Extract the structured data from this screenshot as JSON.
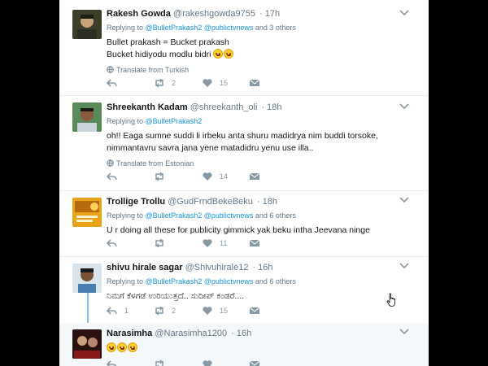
{
  "colors": {
    "accent": "#1b95e0",
    "muted": "#657786",
    "action": "#8899a6",
    "thread": "#80c6ea"
  },
  "tweets": [
    {
      "name": "Rakesh Gowda",
      "handle": "@rakeshgowda9755",
      "time": "17h",
      "replying_prefix": "Replying to ",
      "mentions": "@BulletPrakash2 @publictvnews",
      "replying_suffix": " and 3 others",
      "lines": [
        "Bullet prakash = Bucket prakash",
        "Bucket hidiyodu modlu bidri"
      ],
      "emoji_count": 2,
      "translate": "Translate from Turkish",
      "reply_count": "",
      "retweet_count": "2",
      "like_count": "15",
      "avatar_icon": "avatar-man-photo"
    },
    {
      "name": "Shreekanth Kadam",
      "handle": "@shreekanth_oli",
      "time": "18h",
      "replying_prefix": "Replying to ",
      "mentions": "@BulletPrakash2",
      "replying_suffix": "",
      "lines": [
        "oh!! Eaga sumne suddi li irbeku anta shuru madidrya nim buddi torsoke,",
        "nimmantavru savra jana yene matadidru yenu use illa.."
      ],
      "translate": "Translate from Estonian",
      "reply_count": "",
      "retweet_count": "",
      "like_count": "14",
      "avatar_icon": "avatar-man-photo"
    },
    {
      "name": "Trollige Trollu",
      "handle": "@GudFrndBekeBeku",
      "time": "18h",
      "replying_prefix": "Replying to ",
      "mentions": "@BulletPrakash2 @publictvnews",
      "replying_suffix": " and 6 others",
      "lines": [
        "U r doing all these for publicity gimmick yak beku intha Jeevana ninge"
      ],
      "reply_count": "",
      "retweet_count": "",
      "like_count": "11",
      "avatar_icon": "avatar-logo"
    },
    {
      "name": "shivu hirale sagar",
      "handle": "@Shivuhirale12",
      "time": "16h",
      "replying_prefix": "Replying to ",
      "mentions": "@BulletPrakash2 @publictvnews",
      "replying_suffix": " and 6 others",
      "lines": [
        "ನಿಮಗೆ ಕೆಳಗಡೆ ಉರಿಯುತ್ತದೆ.. ಸುದೀಪ್ ಕಂಡರೆ...."
      ],
      "reply_count": "1",
      "retweet_count": "2",
      "like_count": "15",
      "avatar_icon": "avatar-man-photo"
    },
    {
      "name": "Narasimha",
      "handle": "@Narasimha1200",
      "time": "16h",
      "lines": [],
      "emoji_count": 3,
      "avatar_icon": "avatar-movie-poster"
    }
  ]
}
